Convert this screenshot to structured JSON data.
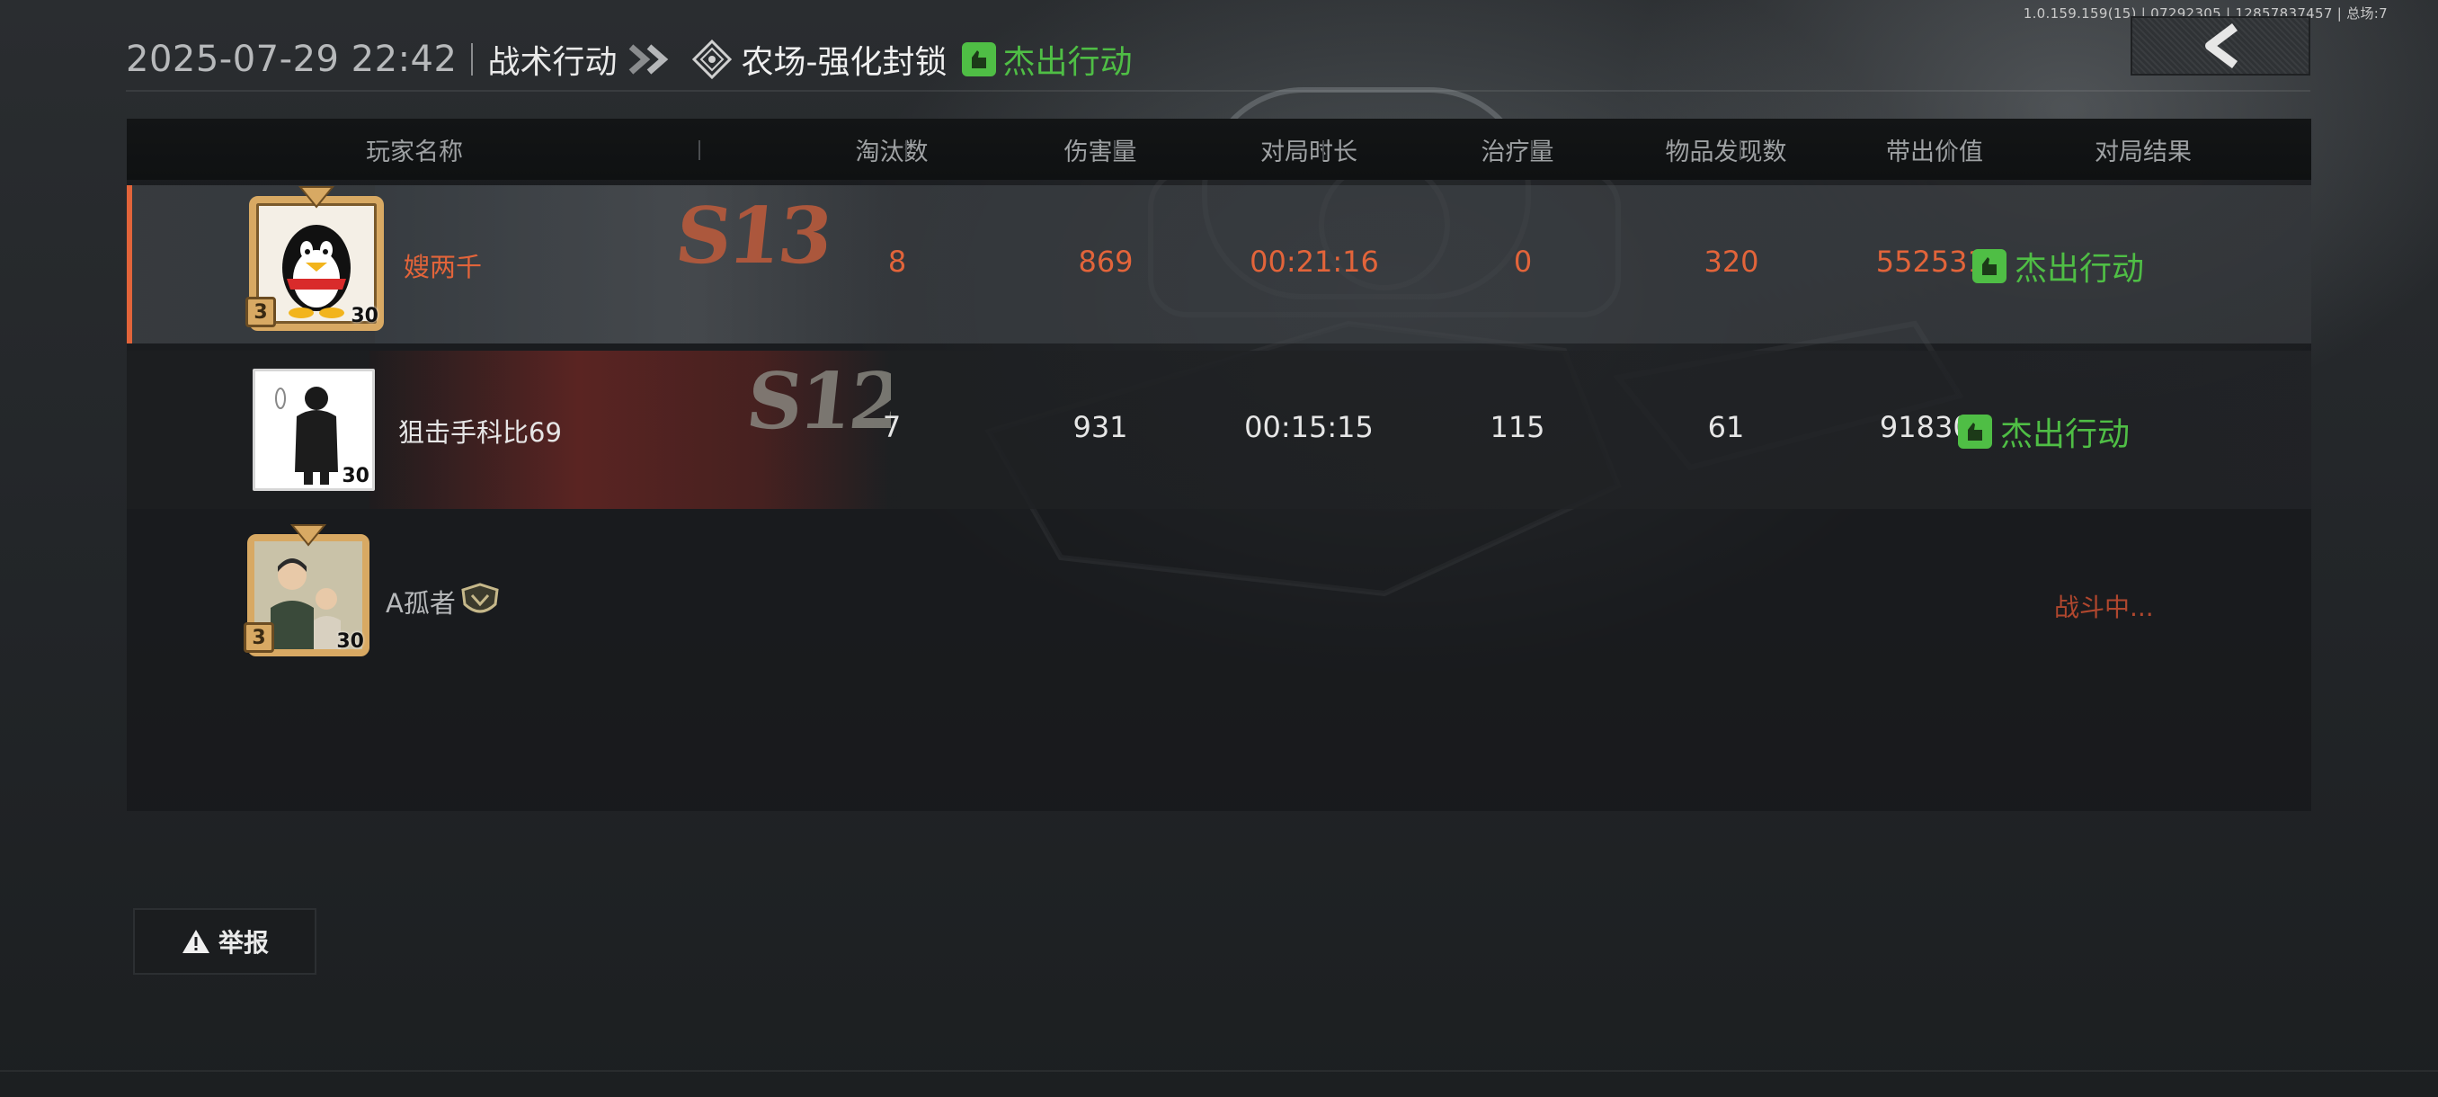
{
  "build_info": "1.0.159.159(15) | 07292305 | 12857837457 | 总场:7",
  "header": {
    "datetime": "2025-07-29 22:42",
    "mode": "战术行动",
    "map": "农场-强化封锁",
    "result": "杰出行动"
  },
  "columns": [
    "玩家名称",
    "淘汰数",
    "伤害量",
    "对局时长",
    "治疗量",
    "物品发现数",
    "带出价值",
    "对局结果"
  ],
  "players": [
    {
      "name": "嫂两千",
      "level": "30",
      "season": "S13",
      "eliminations": "8",
      "damage": "869",
      "duration": "00:21:16",
      "healing": "0",
      "items_found": "320",
      "extract_value": "5525315",
      "result": "杰出行动",
      "highlight": true
    },
    {
      "name": "狙击手科比69",
      "level": "30",
      "season": "S12",
      "eliminations": "7",
      "damage": "931",
      "duration": "00:15:15",
      "healing": "115",
      "items_found": "61",
      "extract_value": "918306",
      "result": "杰出行动",
      "highlight": false
    },
    {
      "name": "A孤者",
      "level": "30",
      "status": "战斗中..."
    }
  ],
  "report_label": "举报",
  "colors": {
    "highlight": "#e2643a",
    "success": "#4fbe45",
    "in_progress": "#b0472e"
  },
  "icons": [
    "back-arrow-icon",
    "double-chevron-icon",
    "map-diamond-icon",
    "success-hand-icon",
    "warning-icon",
    "rank-badge-icon"
  ]
}
